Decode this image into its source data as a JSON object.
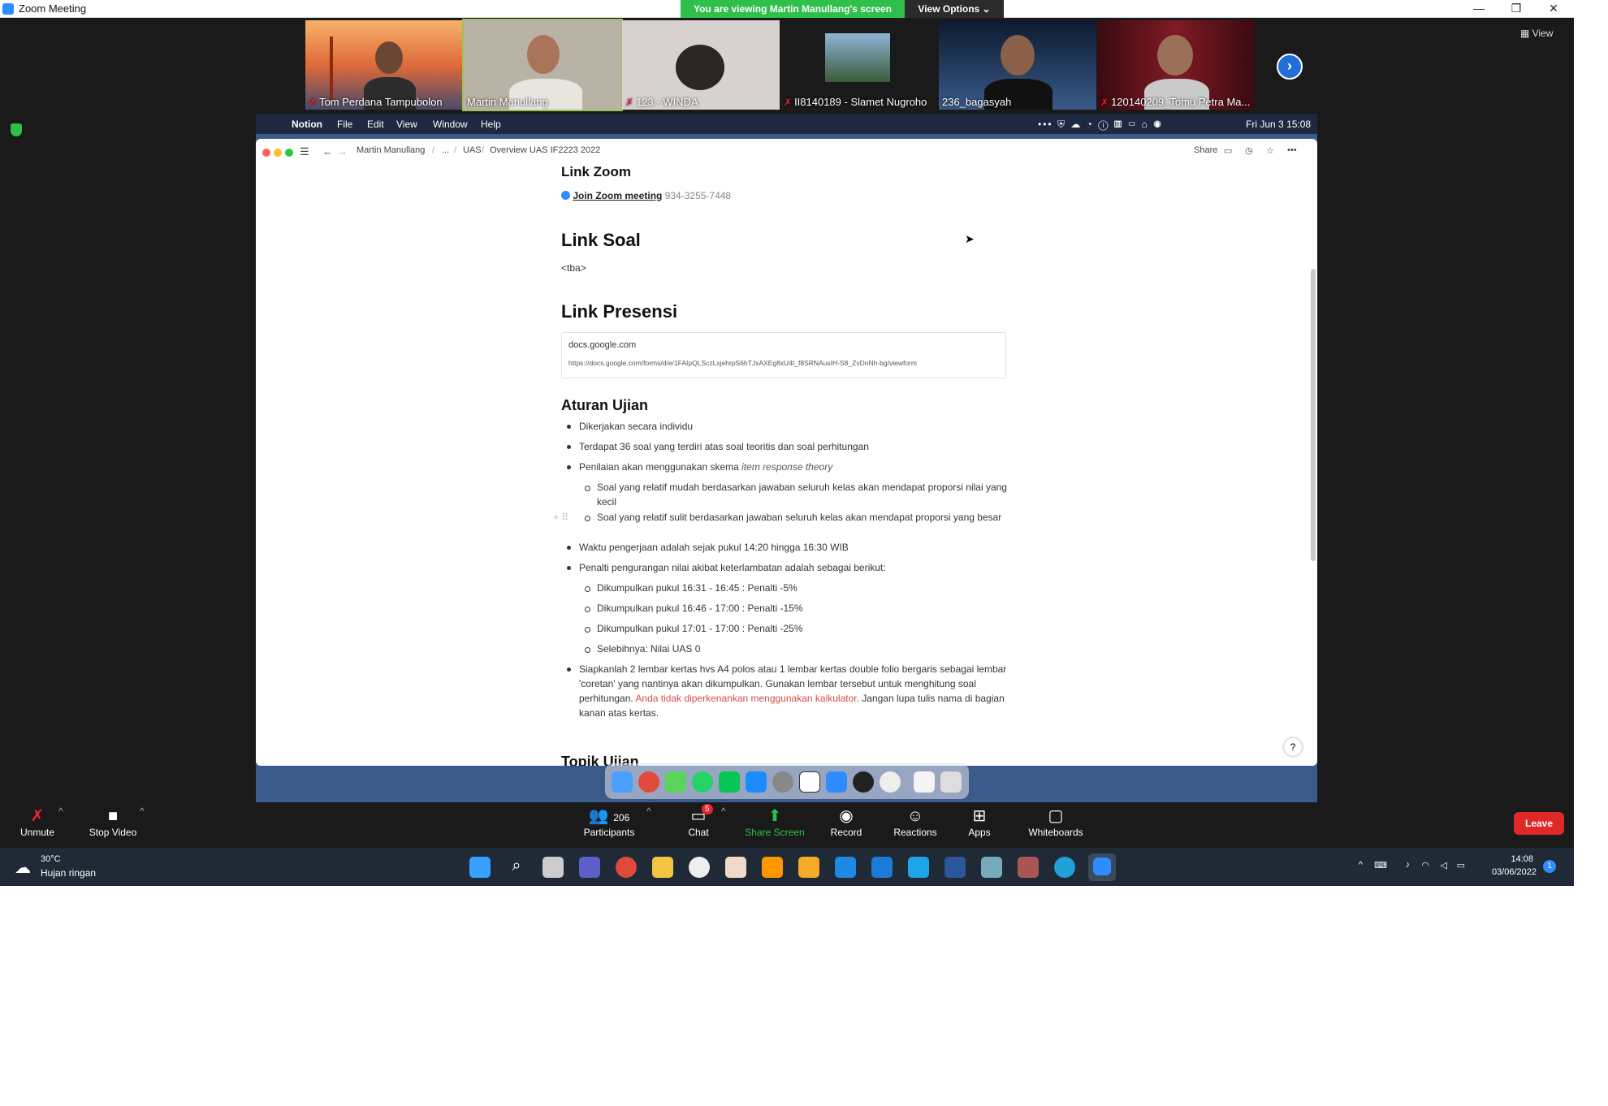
{
  "window": {
    "title": "Zoom Meeting",
    "minimize": "—",
    "restore": "❐",
    "close": "✕"
  },
  "banner": {
    "text": "You are viewing Martin Manullang's screen",
    "view_options": "View Options ⌄"
  },
  "view_button": "▦ View",
  "participants": [
    {
      "name": "Tom Perdana Tampubolon",
      "muted": true
    },
    {
      "name": "Martin Manullang",
      "muted": false
    },
    {
      "name": "123 - WINDA",
      "muted": true
    },
    {
      "name": "II8140189 - Slamet Nugroho",
      "muted": true
    },
    {
      "name": "236_bagasyah",
      "muted": false
    },
    {
      "name": "120140209_Tomu Petra Ma...",
      "muted": true
    }
  ],
  "mac_menu": {
    "apple": "",
    "app": "Notion",
    "items": [
      "File",
      "Edit",
      "View",
      "Window",
      "Help"
    ],
    "status_icons": "••• ⛨ ☁ ◔ ⓘ ▥ ▭ ⌂ ◉",
    "clock": "Fri Jun 3  15:08"
  },
  "notion": {
    "breadcrumb": [
      "Martin Manullang",
      "/",
      "...",
      "/",
      "UAS",
      "/",
      "Overview UAS IF2223 2022"
    ],
    "share": "Share",
    "link_zoom_title": "Link Zoom",
    "join_zoom": "Join Zoom meeting",
    "meeting_id": "934-3255-7448",
    "link_soal_title": "Link Soal",
    "tba": "<tba>",
    "link_presensi_title": "Link Presensi",
    "bookmark_title": "docs.google.com",
    "bookmark_url": "https://docs.google.com/forms/d/e/1FAIpQLSczLxjehrpS6hTJxAXEg8xU4t_f8SRNAusIH-S8_ZvDnNh-bg/viewform",
    "aturan_title": "Aturan Ujian",
    "rules": [
      {
        "text": "Dikerjakan secara individu",
        "level": 0
      },
      {
        "text": "Terdapat 36 soal yang terdiri atas soal teoritis dan soal perhitungan",
        "level": 0
      },
      {
        "text": "Penilaian akan menggunakan skema ",
        "italic": "item response theory",
        "level": 0
      },
      {
        "text": "Soal yang relatif mudah berdasarkan jawaban seluruh kelas akan mendapat proporsi nilai yang kecil",
        "level": 1
      },
      {
        "text": "Soal yang relatif sulit berdasarkan jawaban seluruh kelas akan mendapat proporsi yang besar",
        "level": 1
      },
      {
        "text": "Waktu pengerjaan adalah sejak pukul 14:20 hingga 16:30 WIB",
        "level": 0
      },
      {
        "text": "Penalti pengurangan nilai akibat keterlambatan adalah sebagai berikut:",
        "level": 0
      },
      {
        "text": "Dikumpulkan pukul 16:31 - 16:45 : Penalti -5%",
        "level": 1
      },
      {
        "text": "Dikumpulkan pukul 16:46 - 17:00 : Penalti -15%",
        "level": 1
      },
      {
        "text": "Dikumpulkan pukul 17:01 - 17:00 : Penalti -25%",
        "level": 1
      },
      {
        "text": "Selebihnya: Nilai UAS 0",
        "level": 1
      }
    ],
    "last_rule_a": "Siapkanlah 2 lembar kertas hvs A4 polos atau 1 lembar kertas double folio bergaris sebagai lembar 'coretan' yang nantinya akan dikumpulkan. Gunakan lembar tersebut untuk menghitung soal perhitungan. ",
    "last_rule_red": "Anda tidak diperkenankan menggunakan kalkulator",
    "last_rule_b": ". Jangan lupa tulis nama di bagian kanan atas kertas.",
    "topik_title": "Topik Ujian",
    "help": "?"
  },
  "toolbar": {
    "unmute": "Unmute",
    "stop_video": "Stop Video",
    "participants_count": "206",
    "participants": "Participants",
    "chat": "Chat",
    "chat_badge": "5",
    "share_screen": "Share Screen",
    "record": "Record",
    "reactions": "Reactions",
    "apps": "Apps",
    "whiteboards": "Whiteboards",
    "leave": "Leave"
  },
  "taskbar": {
    "temp": "30°C",
    "weather": "Hujan ringan",
    "time": "14:08",
    "date": "03/06/2022",
    "notif": "1"
  },
  "colors": {
    "zoom_blue": "#2d8cff",
    "banner_green": "#2ec04b",
    "leave_red": "#e02828"
  }
}
